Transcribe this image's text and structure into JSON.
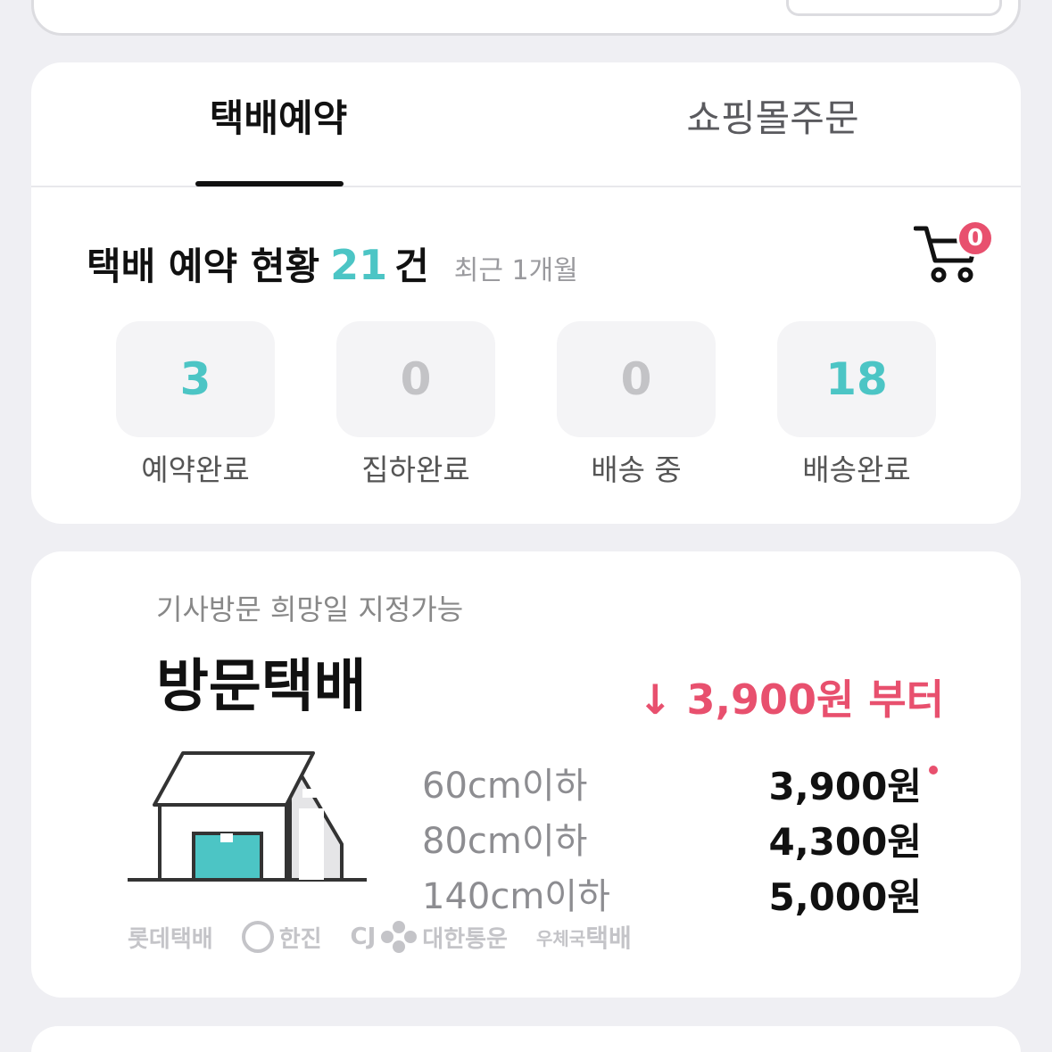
{
  "tabs": [
    {
      "label": "택배예약",
      "active": true
    },
    {
      "label": "쇼핑몰주문",
      "active": false
    }
  ],
  "summary": {
    "title": "택배 예약 현황",
    "count": "21",
    "unit": "건",
    "period": "최근 1개월"
  },
  "cart": {
    "badge": "0"
  },
  "stats": [
    {
      "value": "3",
      "label": "예약완료"
    },
    {
      "value": "0",
      "label": "집하완료"
    },
    {
      "value": "0",
      "label": "배송 중"
    },
    {
      "value": "18",
      "label": "배송완료"
    }
  ],
  "visit": {
    "subtitle": "기사방문 희망일 지정가능",
    "title": "방문택배",
    "from_price": "↓ 3,900원 부터",
    "rates": [
      {
        "size": "60cm이하",
        "price": "3,900원"
      },
      {
        "size": "80cm이하",
        "price": "4,300원"
      },
      {
        "size": "140cm이하",
        "price": "5,000원"
      }
    ],
    "carriers": [
      "롯데택배",
      "한진",
      "CJ",
      "대한통운",
      "우체국",
      "택배"
    ]
  },
  "colors": {
    "accent_teal": "#4cc5c5",
    "accent_pink": "#e8506e",
    "background": "#efeff3"
  },
  "icons": [
    "cart-icon",
    "house-illustration",
    "hanjin-logo-icon",
    "cj-logo-icon"
  ]
}
